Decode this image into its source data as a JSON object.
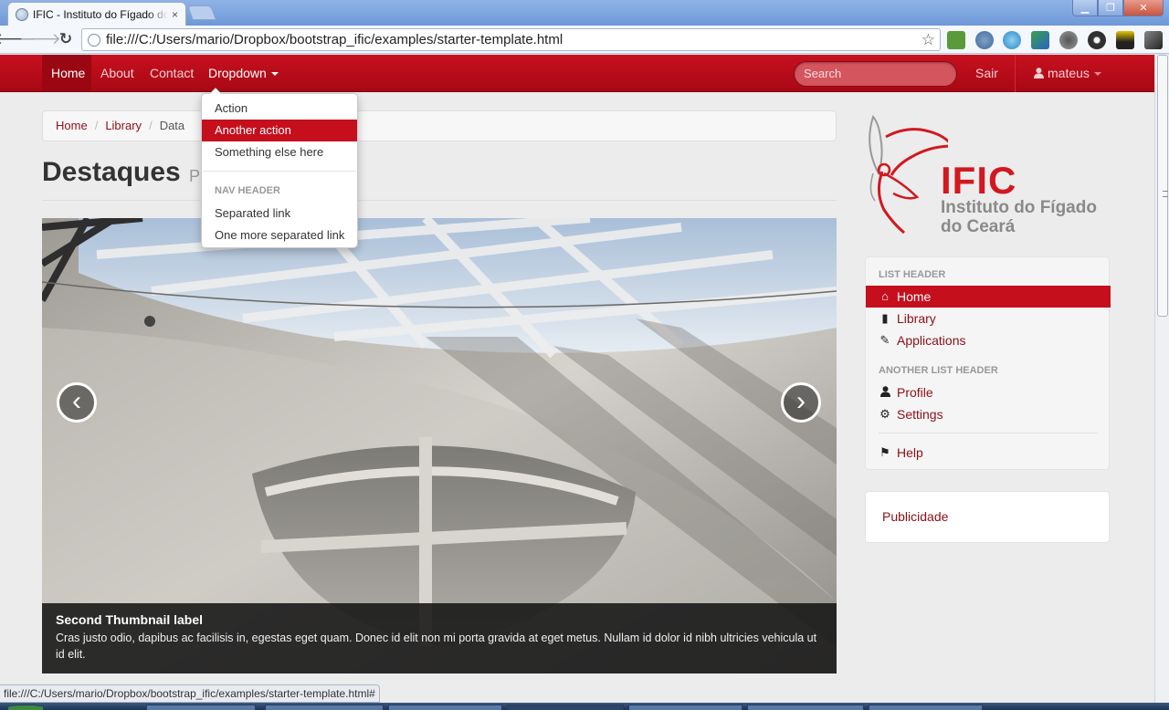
{
  "browser": {
    "tab_title": "IFIC - Instituto do Fígado do Ceará",
    "tab_close": "×",
    "url": "file:///C:/Users/mario/Dropbox/bootstrap_ific/examples/starter-template.html",
    "status_url": "file:///C:/Users/mario/Dropbox/bootstrap_ific/examples/starter-template.html#",
    "window_buttons": {
      "minimize": "▁",
      "maximize": "❐",
      "close": "✕"
    },
    "nav_icons": {
      "back": "🡐",
      "forward": "🡒",
      "reload": "↻",
      "star": "☆"
    },
    "extensions": [
      "evernote-icon",
      "cloud-icon",
      "swirl-icon",
      "translate-icon",
      "bug-icon",
      "camera-icon",
      "plug-icon",
      "wrench-icon"
    ]
  },
  "navbar": {
    "items": [
      {
        "label": "Home",
        "active": true
      },
      {
        "label": "About"
      },
      {
        "label": "Contact"
      },
      {
        "label": "Dropdown"
      }
    ],
    "search_placeholder": "Search",
    "logout": "Sair",
    "user": "mateus"
  },
  "dropdown": {
    "items": [
      "Action",
      "Another action",
      "Something else here"
    ],
    "hover_index": 1,
    "header": "NAV HEADER",
    "more_items": [
      "Separated link",
      "One more separated link"
    ]
  },
  "breadcrumb": {
    "items": [
      "Home",
      "Library"
    ],
    "active": "Data",
    "separator": "/"
  },
  "page_header": {
    "title": "Destaques",
    "subtitle": "P                               emana"
  },
  "carousel": {
    "prev": "‹",
    "next": "›",
    "caption_title": "Second Thumbnail label",
    "caption_text": "Cras justo odio, dapibus ac facilisis in, egestas eget quam. Donec id elit non mi porta gravida at eget metus. Nullam id dolor id nibh ultricies vehicula ut id elit."
  },
  "logo": {
    "acronym": "IFIC",
    "line1": "Instituto do Fígado",
    "line2": "do Ceará"
  },
  "sidebar": {
    "header1": "LIST HEADER",
    "items1": [
      {
        "label": "Home",
        "icon": "⌂",
        "active": true
      },
      {
        "label": "Library",
        "icon": "▮"
      },
      {
        "label": "Applications",
        "icon": "✎"
      }
    ],
    "header2": "ANOTHER LIST HEADER",
    "items2": [
      {
        "label": "Profile",
        "icon": "👤"
      },
      {
        "label": "Settings",
        "icon": "⚙"
      }
    ],
    "help": {
      "label": "Help",
      "icon": "⚑"
    }
  },
  "ad": {
    "label": "Publicidade"
  },
  "colors": {
    "brand": "#c50f1d",
    "link": "#8c0f18",
    "logo_red": "#d21820"
  }
}
